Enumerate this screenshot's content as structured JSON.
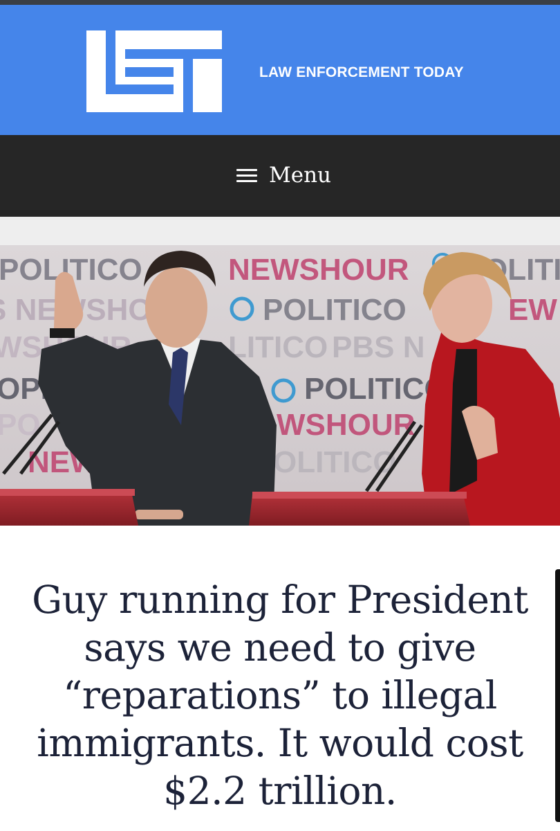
{
  "header": {
    "logo_text": "LET",
    "site_title": "LAW ENFORCEMENT TODAY",
    "brand_color": "#4585ea"
  },
  "nav": {
    "menu_label": "Menu",
    "menu_icon": "hamburger-icon",
    "background": "#262626"
  },
  "hero_image": {
    "backdrop_text": [
      "POLITICO",
      "PBS NEWSHOUR"
    ],
    "description_icon": "photo"
  },
  "article": {
    "headline": "Guy running for President says we need to give “reparations” to illegal immigrants. It would cost $2.2 trillion."
  }
}
